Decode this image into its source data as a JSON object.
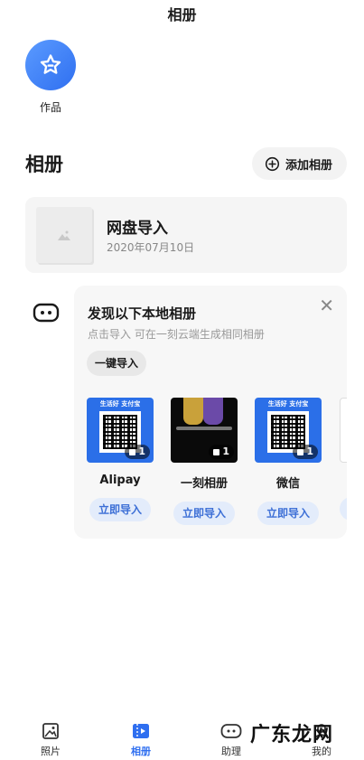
{
  "header": {
    "title": "相册"
  },
  "works": {
    "label": "作品",
    "icon": "star-icon"
  },
  "albums_section": {
    "heading": "相册",
    "add_button": "添加相册"
  },
  "album_card": {
    "name": "网盘导入",
    "date": "2020年07月10日"
  },
  "discover": {
    "title": "发现以下本地相册",
    "subtitle": "点击导入 可在一刻云端生成相同相册",
    "one_key_button": "一键导入",
    "tiles": [
      {
        "name": "Alipay",
        "count": "1",
        "import_label": "立即导入",
        "banner": "生活好 支付宝"
      },
      {
        "name": "一刻相册",
        "count": "1",
        "import_label": "立即导入"
      },
      {
        "name": "微信",
        "count": "1",
        "import_label": "立即导入",
        "banner": "生活好 支付宝"
      }
    ]
  },
  "tabbar": {
    "items": [
      {
        "label": "照片",
        "icon": "photo-icon"
      },
      {
        "label": "相册",
        "icon": "album-icon",
        "active": true
      },
      {
        "label": "助理",
        "icon": "assistant-icon"
      },
      {
        "label": "我的",
        "icon": "profile-icon"
      }
    ]
  },
  "watermark": "广东龙网",
  "colors": {
    "accent": "#2f6ff0",
    "import_bg": "#e3ecfb"
  }
}
